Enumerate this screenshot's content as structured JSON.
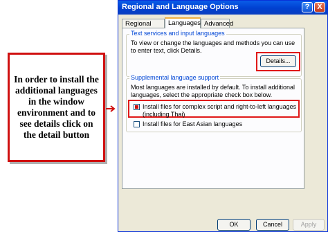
{
  "annotation": {
    "text": "In order to install the additional languages in the window environment and to see details click on the detail button"
  },
  "window": {
    "title": "Regional and Language Options",
    "help_label": "?",
    "close_label": "X"
  },
  "tabs": [
    {
      "label": "Regional Options"
    },
    {
      "label": "Languages"
    },
    {
      "label": "Advanced"
    }
  ],
  "text_services": {
    "legend": "Text services and input languages",
    "description": "To view or change the languages and methods you can use to enter text, click Details.",
    "details_label": "Details..."
  },
  "supplemental": {
    "legend": "Supplemental language support",
    "description": "Most languages are installed by default. To install additional languages, select the appropriate check box below.",
    "complex_script_label": "Install files for complex script and right-to-left languages (including Thai)",
    "complex_script_checked": true,
    "east_asian_label": "Install files for East Asian languages",
    "east_asian_checked": false
  },
  "buttons": {
    "ok_label": "OK",
    "cancel_label": "Cancel",
    "apply_label": "Apply"
  },
  "colors": {
    "annotation_border": "#d01010",
    "titlebar": "#0a5ce8",
    "legend_text": "#0046d5"
  }
}
